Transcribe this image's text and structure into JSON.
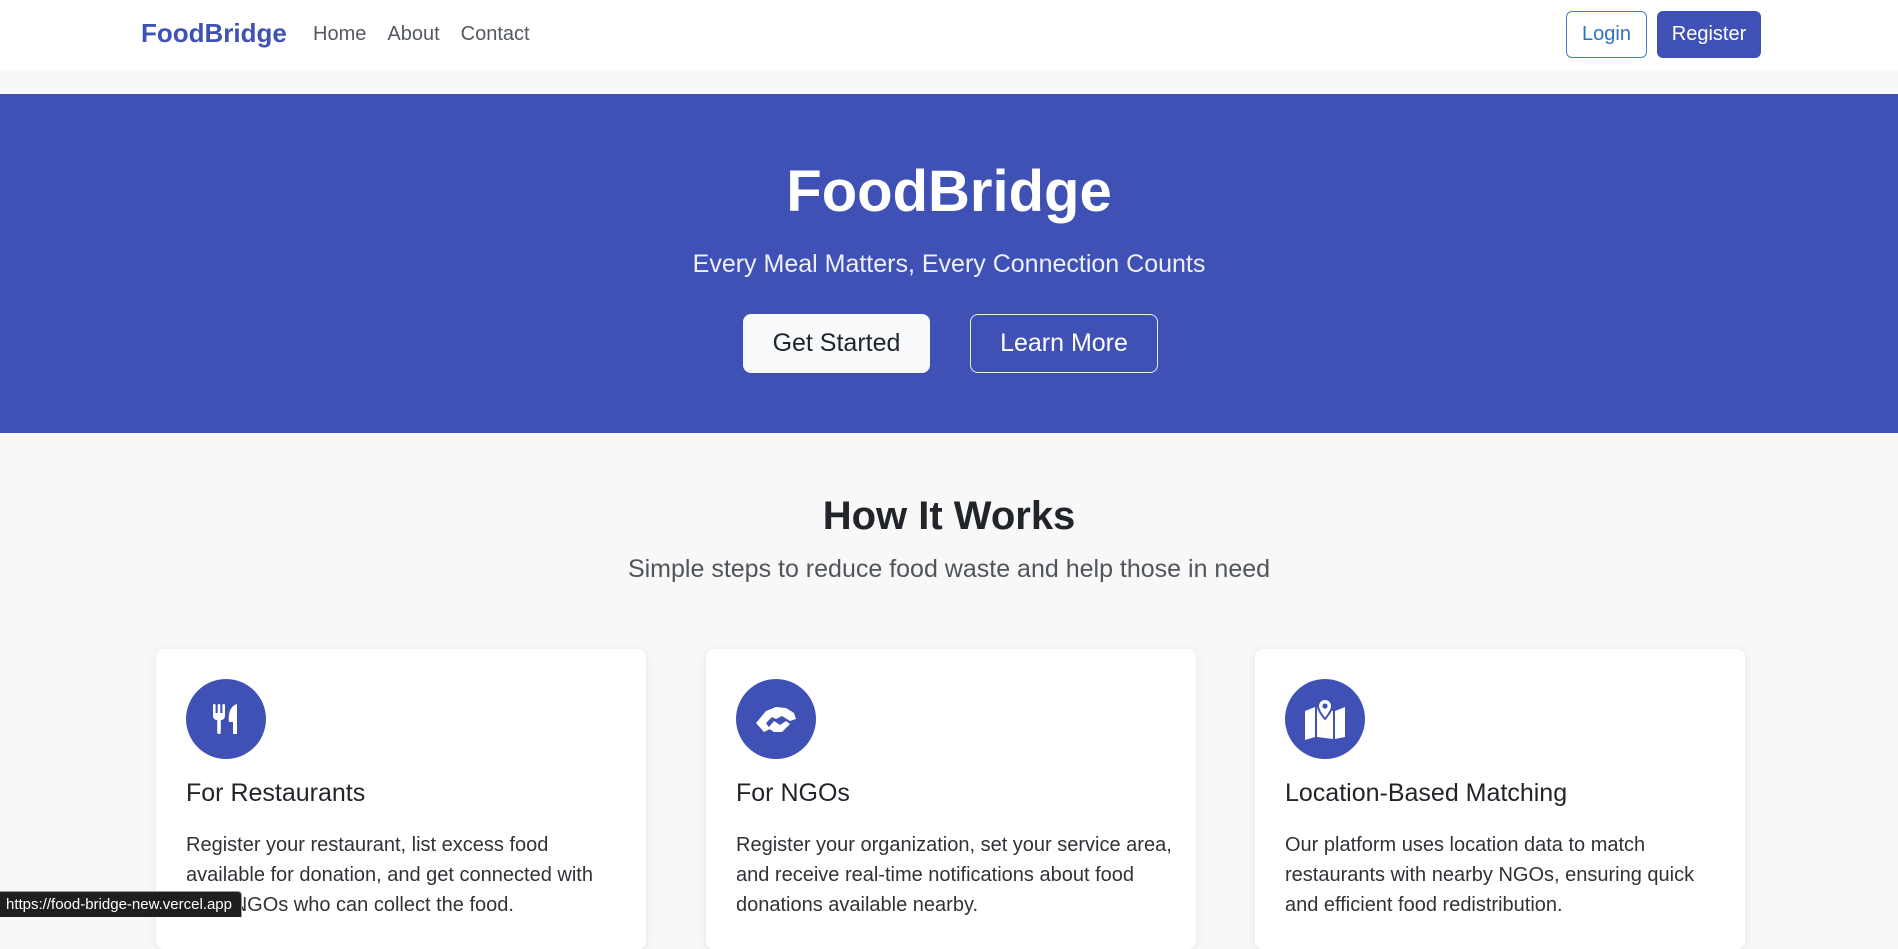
{
  "navbar": {
    "brand": "FoodBridge",
    "links": [
      "Home",
      "About",
      "Contact"
    ],
    "login_label": "Login",
    "register_label": "Register"
  },
  "hero": {
    "title": "FoodBridge",
    "subtitle": "Every Meal Matters, Every Connection Counts",
    "primary_button": "Get Started",
    "secondary_button": "Learn More"
  },
  "how_it_works": {
    "title": "How It Works",
    "subtitle": "Simple steps to reduce food waste and help those in need",
    "cards": [
      {
        "icon": "utensils-icon",
        "title": "For Restaurants",
        "text": "Register your restaurant, list excess food available for donation, and get connected with local NGOs who can collect the food."
      },
      {
        "icon": "handshake-icon",
        "title": "For NGOs",
        "text": "Register your organization, set your service area, and receive real-time notifications about food donations available nearby."
      },
      {
        "icon": "map-location-icon",
        "title": "Location-Based Matching",
        "text": "Our platform uses location data to match restaurants with nearby NGOs, ensuring quick and efficient food redistribution."
      }
    ]
  },
  "status_bar": {
    "url": "https://food-bridge-new.vercel.app"
  },
  "colors": {
    "primary": "#3f51b5",
    "page_background": "#f8f8f8"
  }
}
